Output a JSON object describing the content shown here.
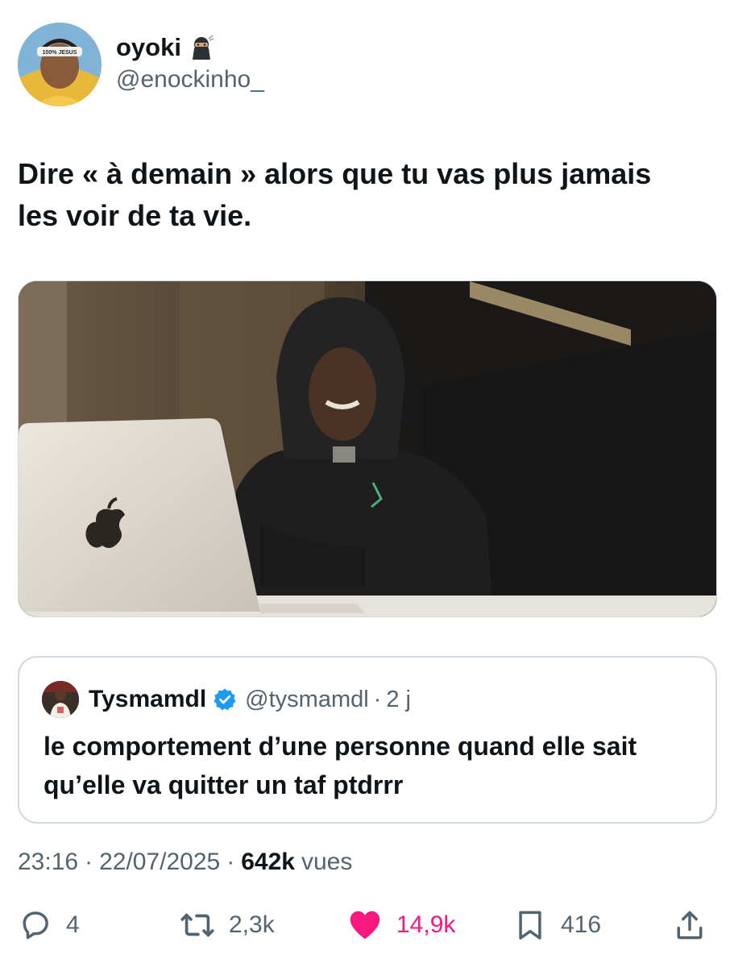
{
  "author": {
    "display_name": "oyoki",
    "handle": "@enockinho_",
    "avatar_headband_text": "100% JESUS"
  },
  "tweet": {
    "text": "Dire « à demain » alors que tu vas plus jamais\nles voir de ta vie."
  },
  "quoted_tweet": {
    "display_name": "Tysmamdl",
    "handle": "@tysmamdl",
    "separator": "·",
    "time": "2 j",
    "text": "le comportement d’une personne quand elle sait qu’elle va quitter un taf ptdrrr"
  },
  "meta": {
    "time": "23:16",
    "separator": "·",
    "date": "22/07/2025",
    "views_count": "642k",
    "views_label": "vues"
  },
  "actions": {
    "replies": "4",
    "retweets": "2,3k",
    "likes": "14,9k",
    "bookmarks": "416"
  },
  "colors": {
    "text_primary": "#0f1419",
    "text_secondary": "#536471",
    "like_pink": "#f91880",
    "verified_blue": "#1d9bf0",
    "border": "#cfd9de"
  },
  "icons": {
    "reply": "reply-icon",
    "retweet": "retweet-icon",
    "like": "heart-icon",
    "bookmark": "bookmark-icon",
    "share": "share-icon",
    "verified": "verified-badge-icon",
    "emoji": "ninja-emoji-icon"
  }
}
